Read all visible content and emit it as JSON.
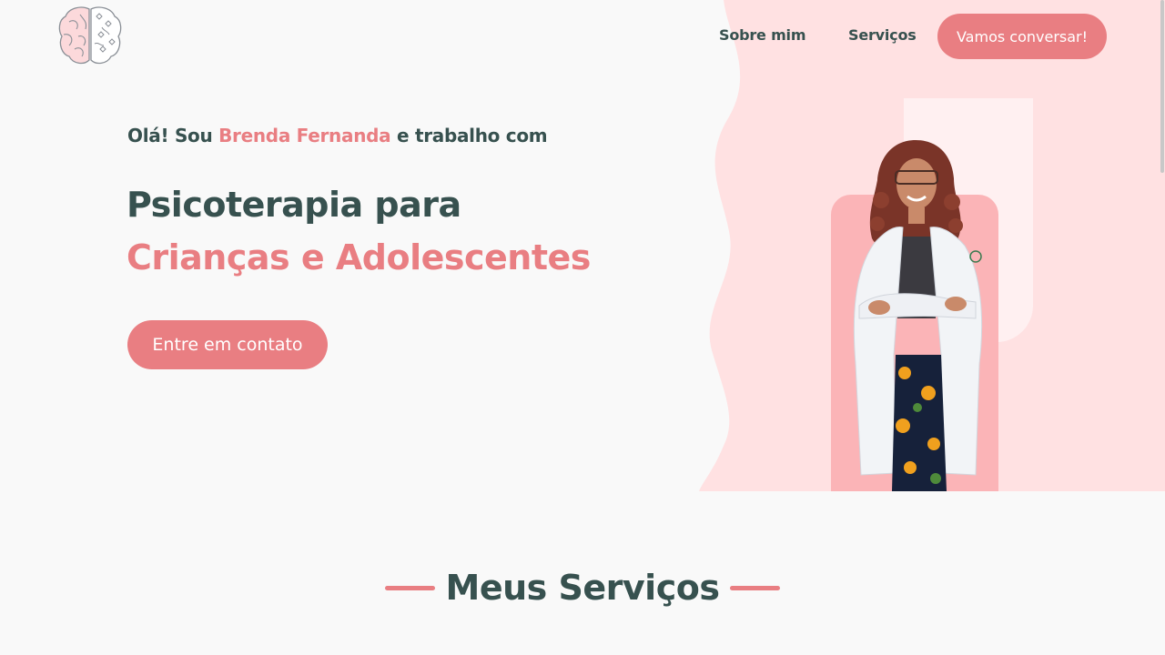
{
  "colors": {
    "accent": "#e97e82",
    "text_dark": "#37514f",
    "hero_blob": "#ffe1e2",
    "photo_panel": "#fbb4b7",
    "background": "#f9f9f9"
  },
  "header": {
    "logo_icon": "brain-logo-icon",
    "nav": {
      "about": "Sobre mim",
      "services": "Serviços",
      "cta": "Vamos conversar!"
    }
  },
  "hero": {
    "intro_before": "Olá! Sou ",
    "intro_name": "Brenda Fernanda",
    "intro_after": " e trabalho com",
    "headline_line1": "Psicoterapia para",
    "headline_line2": "Crianças e Adolescentes",
    "cta": "Entre em contato",
    "photo_icon": "psychologist-portrait"
  },
  "services": {
    "title": "Meus Serviços"
  }
}
